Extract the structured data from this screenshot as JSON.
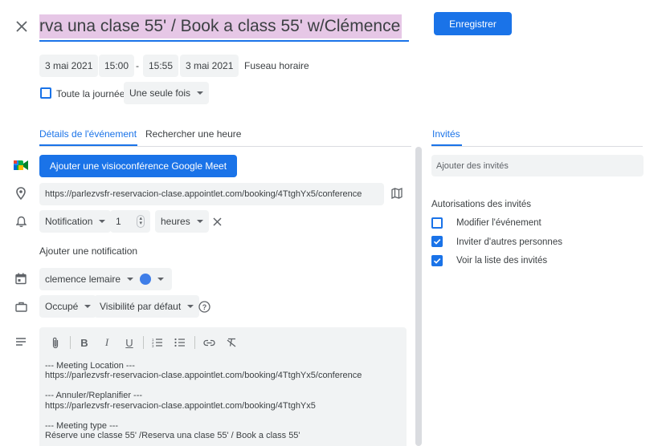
{
  "header": {
    "title_value": "rva una clase 55' / Book a class 55' w/Clémence",
    "save_label": "Enregistrer"
  },
  "datetime": {
    "start_date": "3 mai 2021",
    "start_time": "15:00",
    "separator": "-",
    "end_time": "15:55",
    "end_date": "3 mai 2021",
    "timezone": "Fuseau horaire",
    "all_day_label": "Toute la journée",
    "recurrence": "Une seule fois"
  },
  "tabs": {
    "details": "Détails de l'événement",
    "find_time": "Rechercher une heure",
    "guests": "Invités"
  },
  "details": {
    "meet_button": "Ajouter une visioconférence Google Meet",
    "location": "https://parlezvsfr-reservacion-clase.appointlet.com/booking/4TtghYx5/conference",
    "notification_type": "Notification",
    "notification_value": "1",
    "notification_unit": "heures",
    "add_notification": "Ajouter une notification",
    "calendar": "clemence lemaire",
    "busy": "Occupé",
    "visibility": "Visibilité par défaut"
  },
  "description": {
    "lines": [
      "--- Meeting Location ---",
      "https://parlezvsfr-reservacion-clase.appointlet.com/booking/4TtghYx5/conference",
      "",
      "--- Annuler/Replanifier ---",
      "https://parlezvsfr-reservacion-clase.appointlet.com/booking/4TtghYx5",
      "",
      "--- Meeting type ---",
      "Réserve une classe 55' /Reserva una clase 55' / Book a class 55'"
    ]
  },
  "guests": {
    "add_placeholder": "Ajouter des invités",
    "permissions_title": "Autorisations des invités",
    "permissions": [
      {
        "label": "Modifier l'événement",
        "checked": false
      },
      {
        "label": "Inviter d'autres personnes",
        "checked": true
      },
      {
        "label": "Voir la liste des invités",
        "checked": true
      }
    ]
  },
  "colors": {
    "accent": "#1a73e8",
    "calendar_color": "#3f7ee8",
    "title_highlight": "#e6c7e6"
  }
}
